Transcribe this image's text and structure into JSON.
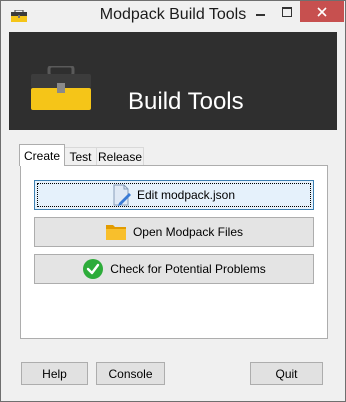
{
  "window": {
    "title": "Modpack Build Tools"
  },
  "banner": {
    "title": "Build Tools"
  },
  "tabs": [
    {
      "label": "Create",
      "active": true
    },
    {
      "label": "Test",
      "active": false
    },
    {
      "label": "Release",
      "active": false
    }
  ],
  "actions": {
    "edit_label": "Edit modpack.json",
    "open_label": "Open Modpack Files",
    "check_label": "Check for Potential Problems"
  },
  "footer": {
    "help_label": "Help",
    "console_label": "Console",
    "quit_label": "Quit"
  },
  "colors": {
    "banner_bg": "#2f2f2f",
    "close_button": "#c7504f",
    "toolbox_yellow": "#f5c518",
    "folder_orange": "#f0a800",
    "check_green": "#2dac3a"
  }
}
